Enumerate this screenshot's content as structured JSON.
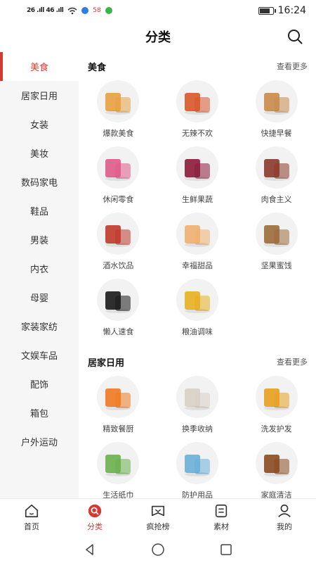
{
  "status_bar": {
    "left": "26 .ıll 46 .ıll",
    "badge": "58",
    "time": "16:24",
    "battery_level": 0.85
  },
  "header": {
    "title": "分类",
    "search_icon": "search-icon"
  },
  "sidebar": {
    "items": [
      {
        "label": "美食",
        "active": true
      },
      {
        "label": "居家日用"
      },
      {
        "label": "女装"
      },
      {
        "label": "美妆"
      },
      {
        "label": "数码家电"
      },
      {
        "label": "鞋品"
      },
      {
        "label": "男装"
      },
      {
        "label": "内衣"
      },
      {
        "label": "母婴"
      },
      {
        "label": "家装家纺"
      },
      {
        "label": "文娱车品"
      },
      {
        "label": "配饰"
      },
      {
        "label": "箱包"
      },
      {
        "label": "户外运动"
      }
    ]
  },
  "sections": [
    {
      "title": "美食",
      "more": "查看更多",
      "items": [
        {
          "label": "爆款美食",
          "color": "#e8a040"
        },
        {
          "label": "无辣不欢",
          "color": "#d9582b"
        },
        {
          "label": "快捷早餐",
          "color": "#c98a4b"
        },
        {
          "label": "休闲零食",
          "color": "#e05a8a"
        },
        {
          "label": "生鲜果蔬",
          "color": "#8b1a3a"
        },
        {
          "label": "肉食主义",
          "color": "#8a3a2a"
        },
        {
          "label": "酒水饮品",
          "color": "#c0392b"
        },
        {
          "label": "幸福甜品",
          "color": "#f0b070"
        },
        {
          "label": "坚果蜜饯",
          "color": "#9b6b3a"
        },
        {
          "label": "懒人速食",
          "color": "#1a1a1a"
        },
        {
          "label": "粮油调味",
          "color": "#e8b020"
        }
      ]
    },
    {
      "title": "居家日用",
      "more": "查看更多",
      "items": [
        {
          "label": "精致餐厨",
          "color": "#f07a20"
        },
        {
          "label": "换季收纳",
          "color": "#d8d0c4"
        },
        {
          "label": "洗发护发",
          "color": "#e8a020"
        },
        {
          "label": "生活纸巾",
          "color": "#6ab04c"
        },
        {
          "label": "防护用品",
          "color": "#6ab0d8"
        },
        {
          "label": "家庭清洁",
          "color": "#8a4a20"
        }
      ]
    }
  ],
  "tabbar": {
    "items": [
      {
        "label": "首页",
        "icon": "home-icon"
      },
      {
        "label": "分类",
        "icon": "category-icon",
        "active": true
      },
      {
        "label": "疯抢榜",
        "icon": "ranking-icon"
      },
      {
        "label": "素材",
        "icon": "material-icon"
      },
      {
        "label": "我的",
        "icon": "profile-icon"
      }
    ]
  },
  "navbar": {
    "back": "back-icon",
    "home": "home-nav-icon",
    "recents": "recents-icon"
  }
}
